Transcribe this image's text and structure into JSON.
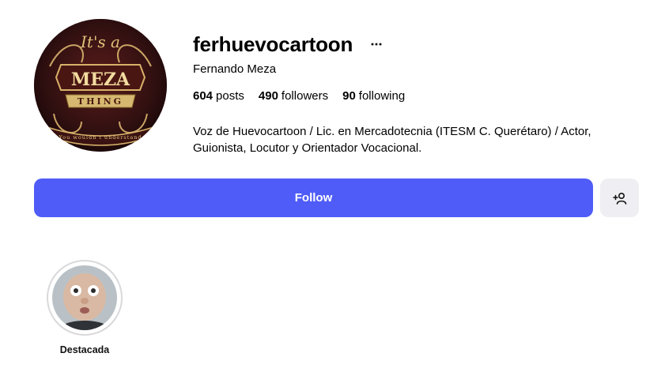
{
  "profile": {
    "username": "ferhuevocartoon",
    "full_name": "Fernando Meza",
    "stats": {
      "posts_count": "604",
      "posts_label": "posts",
      "followers_count": "490",
      "followers_label": "followers",
      "following_count": "90",
      "following_label": "following"
    },
    "bio_line1": "Voz de Huevocartoon / Lic. en Mercadotecnia (ITESM C. Querétaro) / Actor,",
    "bio_line2": "Guionista, Locutor y Orientador Vocacional.",
    "avatar_logo": {
      "top": "It's a",
      "main": "MEZA",
      "ribbon": "THING",
      "lower": "You wouldn't understand"
    }
  },
  "actions": {
    "follow_label": "Follow",
    "suggest_icon": "person-add-icon",
    "more_icon": "ellipsis-icon"
  },
  "highlights": [
    {
      "label": "Destacada"
    }
  ],
  "colors": {
    "follow_button": "#4f5cf7",
    "secondary_button": "#efeff3"
  }
}
